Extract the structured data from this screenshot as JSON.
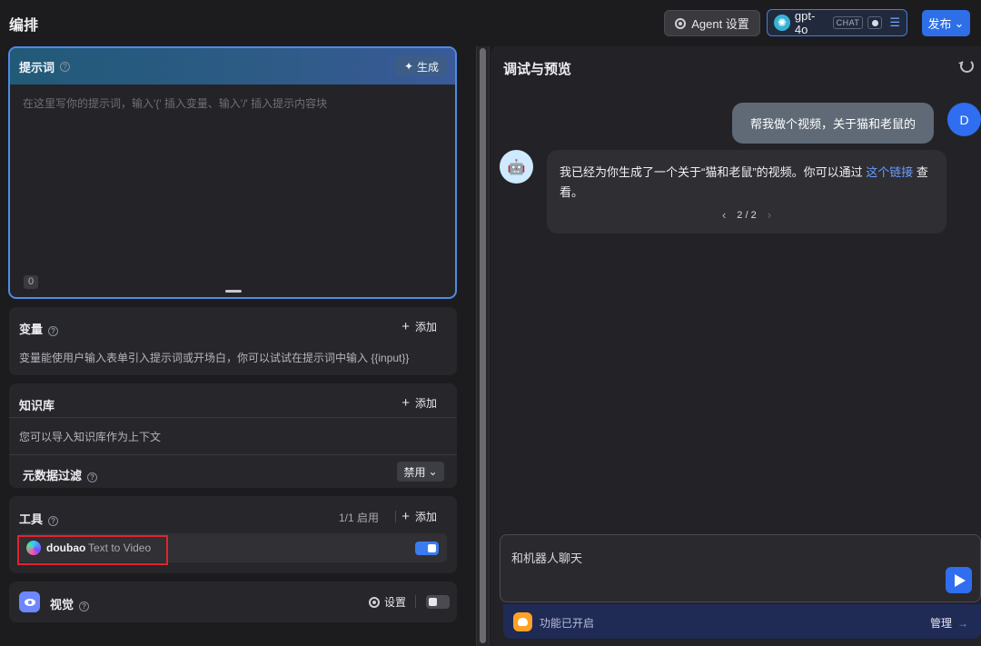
{
  "header": {
    "title": "编排",
    "agent_settings_label": "Agent 设置",
    "model": {
      "name": "gpt-4o",
      "tag": "CHAT"
    },
    "publish_label": "发布"
  },
  "prompt": {
    "title": "提示词",
    "generate_label": "生成",
    "placeholder": "在这里写你的提示词，输入'{' 插入变量、输入'/' 插入提示内容块",
    "char_count": "0"
  },
  "variables": {
    "title": "变量",
    "add_label": "添加",
    "description": "变量能使用户输入表单引入提示词或开场白，你可以试试在提示词中输入 {{input}}"
  },
  "knowledge": {
    "title": "知识库",
    "add_label": "添加",
    "description": "您可以导入知识库作为上下文",
    "filter_title": "元数据过滤",
    "filter_value": "禁用"
  },
  "tools": {
    "title": "工具",
    "enabled_count": "1/1 启用",
    "add_label": "添加",
    "items": [
      {
        "provider": "doubao",
        "name": "Text to Video",
        "enabled": true
      }
    ]
  },
  "vision": {
    "title": "视觉",
    "settings_label": "设置",
    "enabled": false
  },
  "debug": {
    "title": "调试与预览",
    "messages": [
      {
        "role": "user",
        "text": "帮我做个视频，关于猫和老鼠的",
        "avatar": "D"
      },
      {
        "role": "assistant",
        "text_before": "我已经为你生成了一个关于“猫和老鼠”的视频。你可以通过 ",
        "link_text": "这个链接",
        "text_after": " 查看。",
        "pager": "2 / 2"
      }
    ],
    "composer_placeholder": "和机器人聊天",
    "feature_status": "功能已开启",
    "manage_label": "管理"
  },
  "colors": {
    "accent": "#2f6ef0",
    "highlight_border": "#e0242f",
    "link": "#6a9eff"
  }
}
